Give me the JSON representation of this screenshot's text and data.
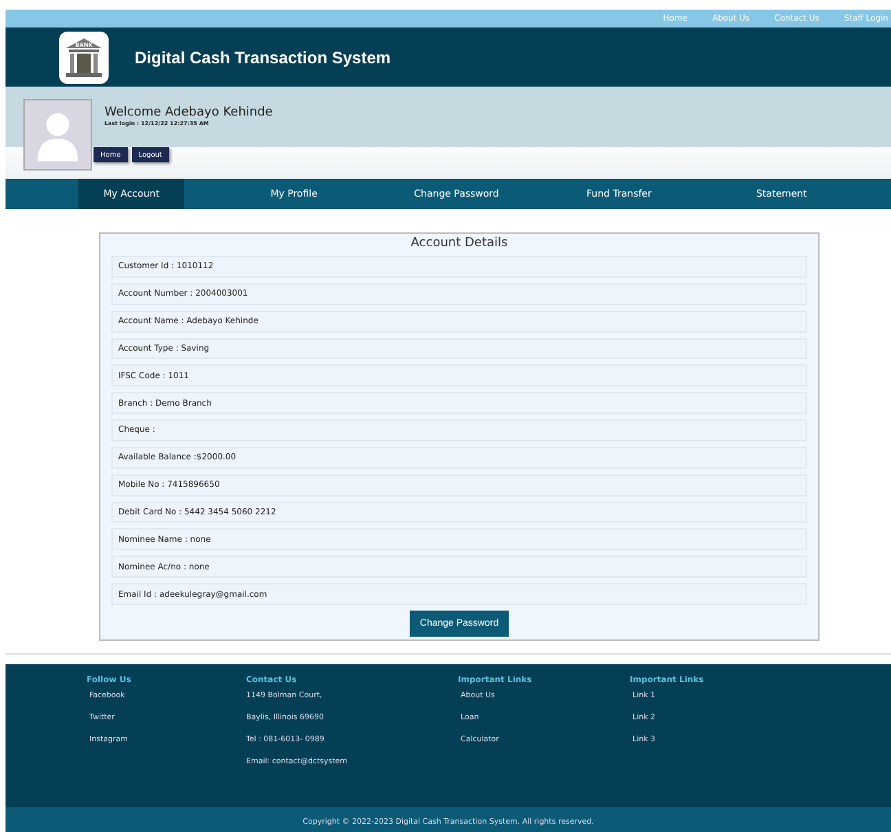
{
  "top_links": [
    "Home",
    "About Us",
    "Contact Us",
    "Staff Login"
  ],
  "header": {
    "title": "Digital Cash Transaction System",
    "logo_text": "BANK"
  },
  "welcome": {
    "text": "Welcome  Adebayo  Kehinde",
    "last_login": "Last login : 12/12/22 12:27:35 AM",
    "buttons": [
      "Home",
      "Logout"
    ]
  },
  "nav": [
    {
      "label": "My Account",
      "selected": true
    },
    {
      "label": "My Profile",
      "selected": false
    },
    {
      "label": "Change Password",
      "selected": false
    },
    {
      "label": "Fund Transfer",
      "selected": false
    },
    {
      "label": "Statement",
      "selected": false
    }
  ],
  "account": {
    "title": "Account Details",
    "rows": [
      "Customer Id : 1010112",
      "Account Number : 2004003001",
      "Account Name : Adebayo Kehinde",
      "Account Type : Saving",
      "IFSC Code : 1011",
      "Branch : Demo Branch",
      "Cheque :",
      "Available Balance :$2000.00",
      "Mobile No : 7415896650",
      "Debit Card No : 5442 3454 5060 2212",
      "Nominee Name : none",
      "Nominee Ac/no : none",
      "Email Id : adeekulegray@gmail.com"
    ],
    "button": "Change Password"
  },
  "footer": {
    "columns": [
      {
        "heading": "Follow Us",
        "items": [
          "Facebook",
          "Twitter",
          "Instagram"
        ]
      },
      {
        "heading": "Contact Us",
        "items": [
          "1149 Bolman Court,",
          "Baylis, Illinois 69690",
          "Tel : 081-6013- 0989",
          "Email: contact@dctsystem"
        ]
      },
      {
        "heading": "Important Links",
        "items": [
          "About Us",
          "Loan",
          "Calculator"
        ]
      },
      {
        "heading": "Important Links",
        "items": [
          "Link 1",
          "Link 2",
          "Link 3"
        ]
      }
    ],
    "copyright": "Copyright © 2022-2023 Digital Cash Transaction System. All rights reserved."
  }
}
